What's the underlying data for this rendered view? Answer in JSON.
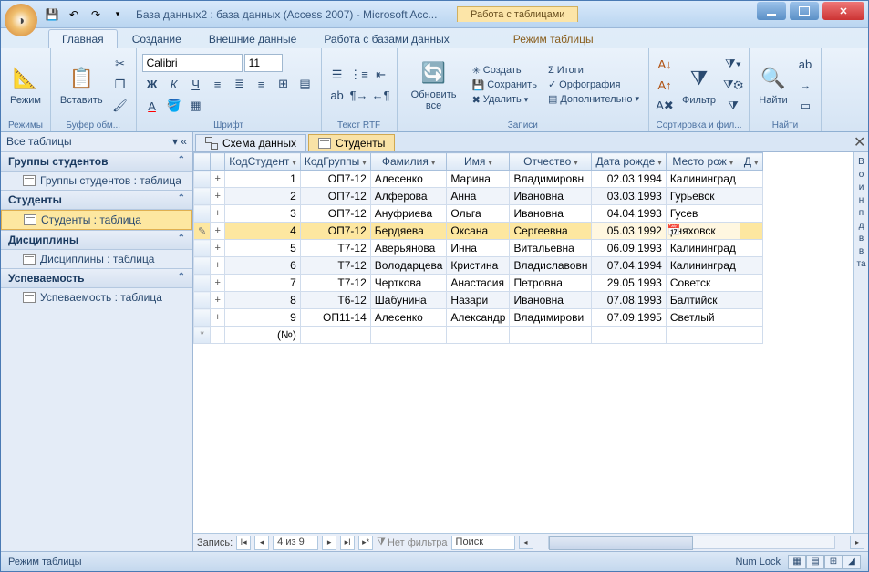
{
  "title": "База данных2 : база данных (Access 2007) - Microsoft Acc...",
  "context_tab": "Работа с таблицами",
  "tabs": {
    "home": "Главная",
    "create": "Создание",
    "external": "Внешние данные",
    "dbtools": "Работа с базами данных",
    "datasheet": "Режим таблицы"
  },
  "ribbon": {
    "groups": {
      "views": "Режимы",
      "clipboard": "Буфер обм...",
      "font": "Шрифт",
      "richtext": "Текст RTF",
      "records": "Записи",
      "sortfilter": "Сортировка и фил...",
      "find": "Найти"
    },
    "view": "Режим",
    "paste": "Вставить",
    "font_name": "Calibri",
    "font_size": "11",
    "refresh": "Обновить все",
    "new": "Создать",
    "save": "Сохранить",
    "delete": "Удалить",
    "totals": "Итоги",
    "spelling": "Орфография",
    "more": "Дополнительно",
    "filter": "Фильтр",
    "find_btn": "Найти"
  },
  "nav": {
    "header": "Все таблицы",
    "groups": [
      {
        "title": "Группы студентов",
        "items": [
          "Группы студентов : таблица"
        ]
      },
      {
        "title": "Студенты",
        "items": [
          "Студенты : таблица"
        ]
      },
      {
        "title": "Дисциплины",
        "items": [
          "Дисциплины : таблица"
        ]
      },
      {
        "title": "Успеваемость",
        "items": [
          "Успеваемость : таблица"
        ]
      }
    ]
  },
  "content_tabs": {
    "schema": "Схема данных",
    "students": "Студенты"
  },
  "columns": [
    "КодСтудент",
    "КодГруппы",
    "Фамилия",
    "Имя",
    "Отчество",
    "Дата рожде",
    "Место рож",
    "Д"
  ],
  "rows": [
    {
      "id": "1",
      "grp": "ОП7-12",
      "fam": "Алесенко",
      "name": "Марина",
      "pat": "Владимировн",
      "dob": "02.03.1994",
      "city": "Калининград"
    },
    {
      "id": "2",
      "grp": "ОП7-12",
      "fam": "Алферова",
      "name": "Анна",
      "pat": "Ивановна",
      "dob": "03.03.1993",
      "city": "Гурьевск"
    },
    {
      "id": "3",
      "grp": "ОП7-12",
      "fam": "Ануфриева",
      "name": "Ольга",
      "pat": "Ивановна",
      "dob": "04.04.1993",
      "city": "Гусев"
    },
    {
      "id": "4",
      "grp": "ОП7-12",
      "fam": "Бердяева",
      "name": "Оксана",
      "pat": "Сергеевна",
      "dob": "05.03.1992",
      "city": "рняховск"
    },
    {
      "id": "5",
      "grp": "Т7-12",
      "fam": "Аверьянова",
      "name": "Инна",
      "pat": "Витальевна",
      "dob": "06.09.1993",
      "city": "Калининград"
    },
    {
      "id": "6",
      "grp": "Т7-12",
      "fam": "Володарцева",
      "name": "Кристина",
      "pat": "Владиславовн",
      "dob": "07.04.1994",
      "city": "Калининград"
    },
    {
      "id": "7",
      "grp": "Т7-12",
      "fam": "Черткова",
      "name": "Анастасия",
      "pat": "Петровна",
      "dob": "29.05.1993",
      "city": "Советск"
    },
    {
      "id": "8",
      "grp": "Т6-12",
      "fam": "Шабунина",
      "name": "Назари",
      "pat": "Ивановна",
      "dob": "07.08.1993",
      "city": "Балтийск"
    },
    {
      "id": "9",
      "grp": "ОП11-14",
      "fam": "Алесенко",
      "name": "Александр",
      "pat": "Владимирови",
      "dob": "07.09.1995",
      "city": "Светлый"
    }
  ],
  "newrow_id": "(№)",
  "recnav": {
    "label": "Запись:",
    "pos": "4 из 9",
    "nofilter": "Нет фильтра",
    "search": "Поиск"
  },
  "status": {
    "mode": "Режим таблицы",
    "numlock": "Num Lock"
  },
  "side_letters": "В\nо\nи\nн\nп\nд\nв\nв\nта"
}
